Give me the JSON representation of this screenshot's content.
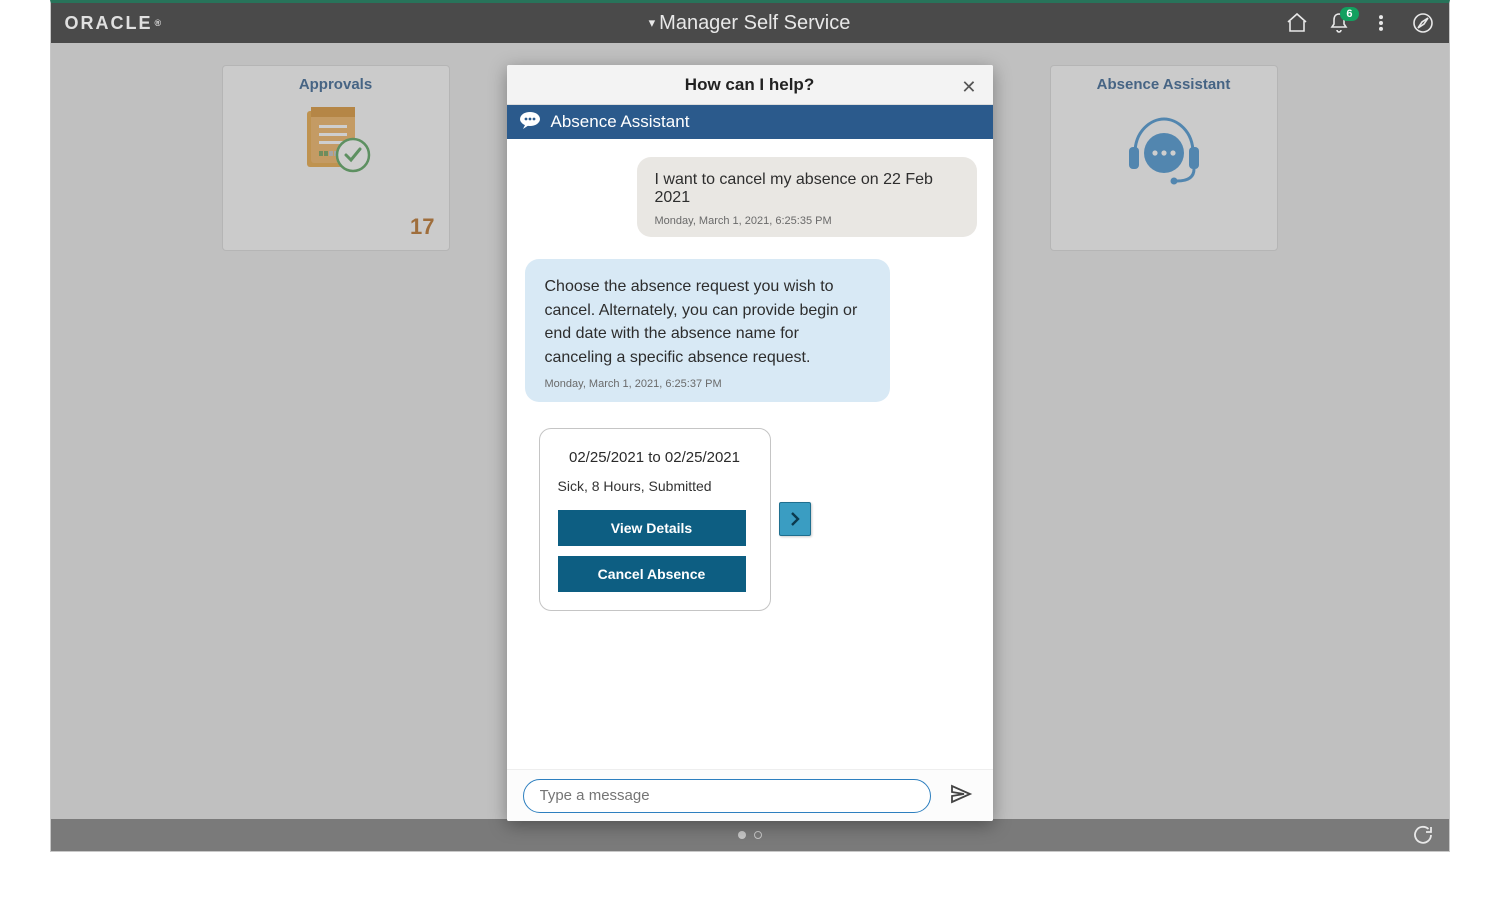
{
  "header": {
    "brand": "ORACLE",
    "title": "Manager Self Service",
    "notification_count": "6"
  },
  "tiles": {
    "approvals": {
      "title": "Approvals",
      "count": "17"
    },
    "assistant": {
      "title": "Absence Assistant"
    }
  },
  "modal": {
    "title": "How can I help?",
    "subtitle": "Absence Assistant",
    "user_msg": {
      "text": "I want to cancel my absence on 22 Feb 2021",
      "time": "Monday, March 1, 2021, 6:25:35 PM"
    },
    "bot_msg": {
      "text": "Choose the absence request you wish to cancel. Alternately, you can provide begin or end date with the absence name for canceling a specific absence request.",
      "time": "Monday, March 1, 2021, 6:25:37 PM"
    },
    "card": {
      "dates": "02/25/2021  to 02/25/2021",
      "subtitle": "Sick, 8 Hours, Submitted",
      "view_label": "View Details",
      "cancel_label": "Cancel Absence"
    },
    "input_placeholder": "Type a message"
  }
}
